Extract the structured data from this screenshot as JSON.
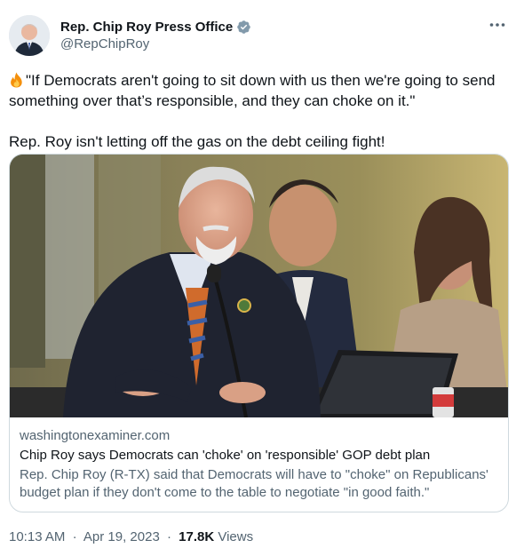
{
  "author": {
    "display_name": "Rep. Chip Roy Press Office",
    "handle": "@RepChipRoy",
    "verified_color": "#829aab"
  },
  "tweet": {
    "line1": "\"If Democrats aren't going to sit down with us then we're going to send something over that’s responsible, and they can choke on it.\"",
    "line2": "Rep. Roy isn't letting off the gas on the debt ceiling fight!",
    "emoji": "fire-icon"
  },
  "card": {
    "domain": "washingtonexaminer.com",
    "title": "Chip Roy says Democrats can 'choke' on 'responsible' GOP debt plan",
    "description": "Rep. Chip Roy (R-TX) said that Democrats will have to \"choke\" on Republicans' budget plan if they don't come to the table to negotiate \"in good faith.\""
  },
  "footer": {
    "time": "10:13 AM",
    "separator": "·",
    "date": "Apr 19, 2023",
    "views_count": "17.8K",
    "views_label": "Views"
  },
  "colors": {
    "text_primary": "#0f1419",
    "text_secondary": "#536471",
    "border": "#cfd9de"
  }
}
